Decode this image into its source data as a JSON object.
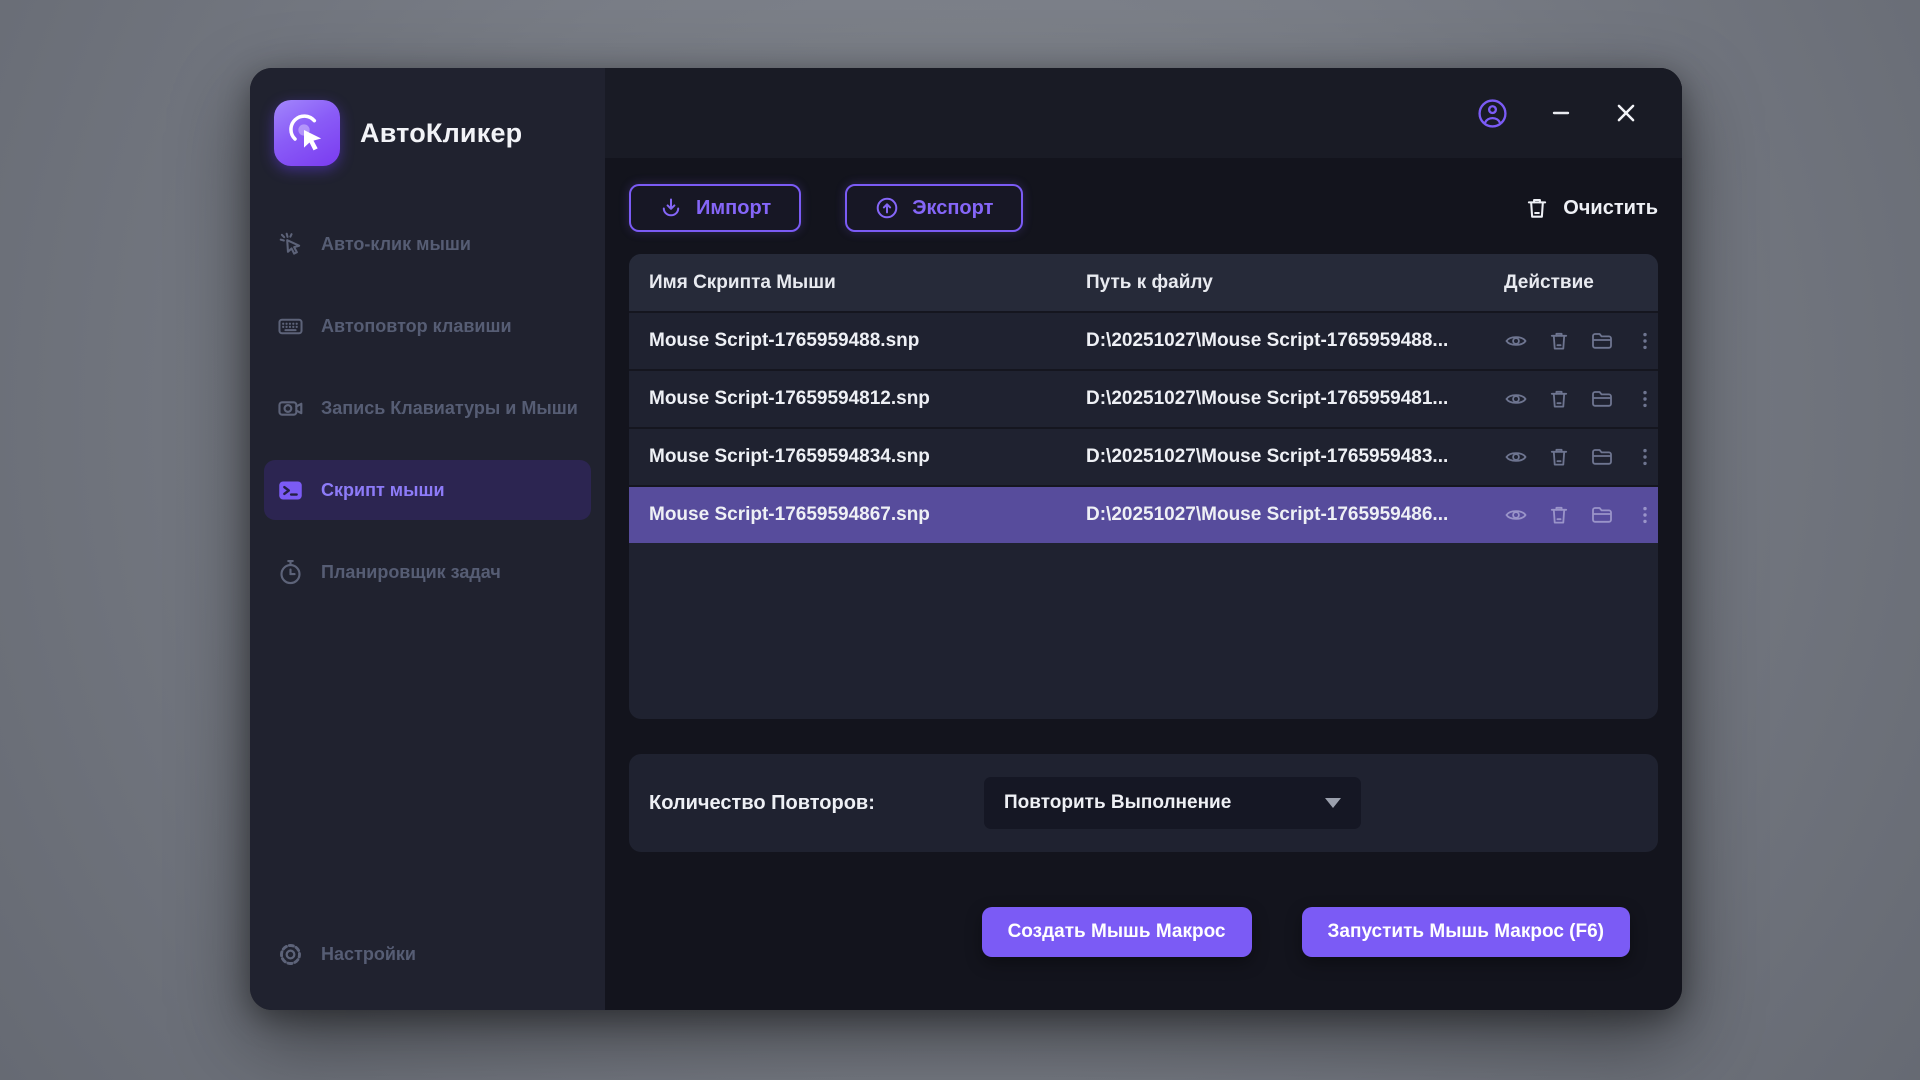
{
  "app": {
    "title": "АвтоКликер"
  },
  "colors": {
    "accent": "#7b5bf5",
    "selected_row": "#574c9c",
    "selected_nav_bg": "#2c2551",
    "panel_bg": "#1f2230",
    "sidebar_bg": "#20222f",
    "main_bg": "#13141d"
  },
  "titlebar": {
    "icons": [
      "user-icon",
      "minimize-icon",
      "close-icon"
    ]
  },
  "sidebar": {
    "items": [
      {
        "label": "Авто-клик мыши",
        "icon": "cursor-click-icon",
        "selected": false
      },
      {
        "label": "Автоповтор клавиши",
        "icon": "keyboard-icon",
        "selected": false
      },
      {
        "label": "Запись Клавиатуры и Мыши",
        "icon": "video-camera-icon",
        "selected": false
      },
      {
        "label": "Скрипт мыши",
        "icon": "terminal-icon",
        "selected": true
      },
      {
        "label": "Планировщик задач",
        "icon": "stopwatch-icon",
        "selected": false
      }
    ],
    "settings_label": "Настройки",
    "settings_icon": "gear-icon"
  },
  "toolbar": {
    "import_label": "Импорт",
    "import_icon": "download-icon",
    "export_label": "Экспорт",
    "export_icon": "upload-icon",
    "clear_label": "Очистить",
    "clear_icon": "trash-icon"
  },
  "table": {
    "headers": [
      "Имя Скрипта Мыши",
      "Путь к файлу",
      "Действие"
    ],
    "row_action_icons": [
      "eye-icon",
      "trash-icon",
      "folder-icon",
      "kebab-menu-icon"
    ],
    "rows": [
      {
        "name": "Mouse Script-1765959488.snp",
        "path": "D:\\20251027\\Mouse Script-1765959488...",
        "selected": false
      },
      {
        "name": "Mouse Script-17659594812.snp",
        "path": "D:\\20251027\\Mouse Script-1765959481...",
        "selected": false
      },
      {
        "name": "Mouse Script-17659594834.snp",
        "path": "D:\\20251027\\Mouse Script-1765959483...",
        "selected": false
      },
      {
        "name": "Mouse Script-17659594867.snp",
        "path": "D:\\20251027\\Mouse Script-1765959486...",
        "selected": true
      }
    ]
  },
  "repeat": {
    "label": "Количество Повторов:",
    "value": "Повторить Выполнение"
  },
  "footer": {
    "create_label": "Создать Мышь Макрос",
    "run_label": "Запустить Мышь Макрос (F6)"
  }
}
